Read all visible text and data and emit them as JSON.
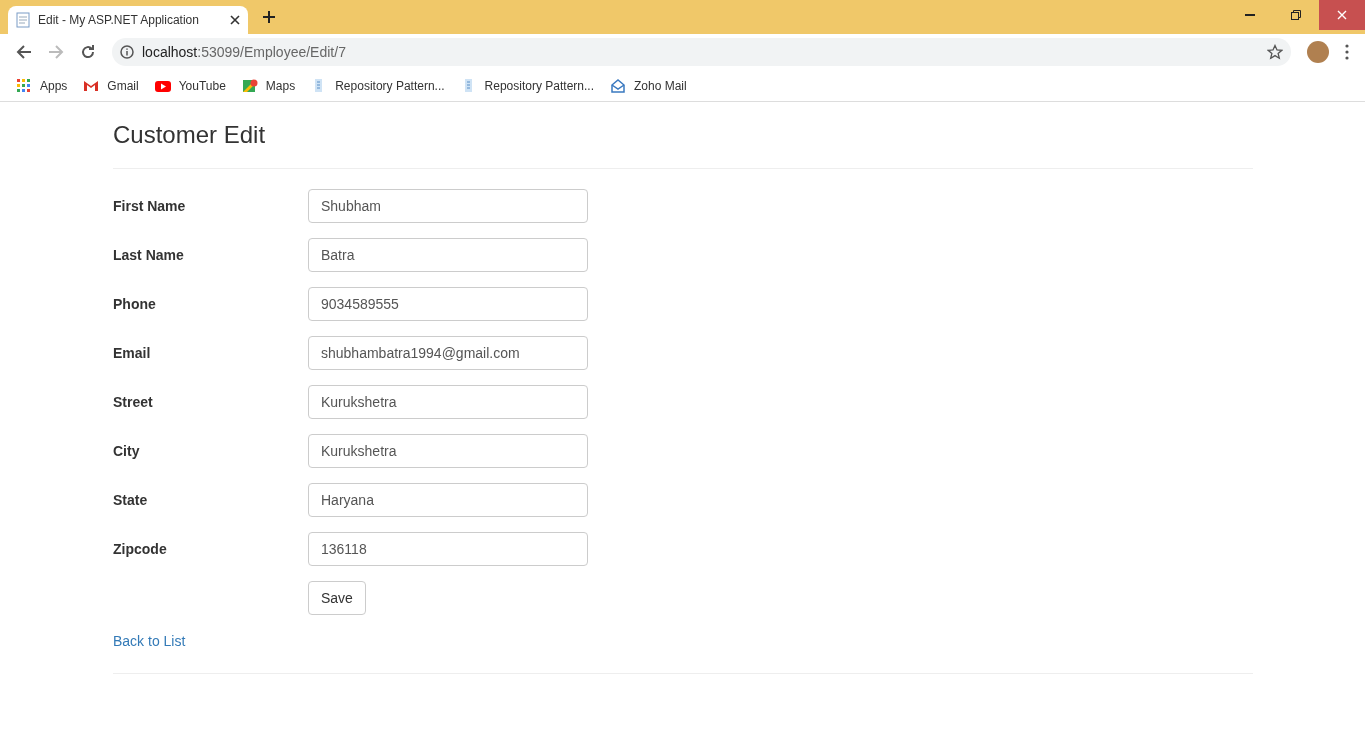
{
  "browser": {
    "tab": {
      "title": "Edit - My ASP.NET Application",
      "selected": true
    },
    "address": {
      "host": "localhost",
      "path": ":53099/Employee/Edit/7"
    },
    "bookmarks": [
      {
        "kind": "apps",
        "label": "Apps"
      },
      {
        "kind": "gmail",
        "label": "Gmail"
      },
      {
        "kind": "youtube",
        "label": "YouTube"
      },
      {
        "kind": "maps",
        "label": "Maps"
      },
      {
        "kind": "page",
        "label": "Repository Pattern..."
      },
      {
        "kind": "page",
        "label": "Repository Pattern..."
      },
      {
        "kind": "mail",
        "label": "Zoho Mail"
      }
    ]
  },
  "page": {
    "title": "Customer Edit",
    "fields": [
      {
        "label": "First Name",
        "value": "Shubham"
      },
      {
        "label": "Last Name",
        "value": "Batra"
      },
      {
        "label": "Phone",
        "value": "9034589555"
      },
      {
        "label": "Email",
        "value": "shubhambatra1994@gmail.com"
      },
      {
        "label": "Street",
        "value": "Kurukshetra"
      },
      {
        "label": "City",
        "value": "Kurukshetra"
      },
      {
        "label": "State",
        "value": "Haryana"
      },
      {
        "label": "Zipcode",
        "value": "136118"
      }
    ],
    "save_button": "Save",
    "back_link": "Back to List"
  }
}
